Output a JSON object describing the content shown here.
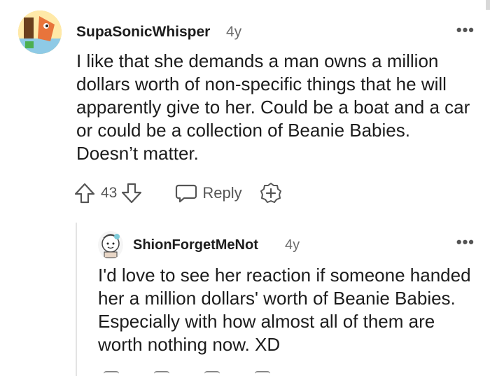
{
  "comments": [
    {
      "author": "SupaSonicWhisper",
      "age": "4y",
      "text": "I like that she demands a man owns a million dollars worth of non-specific things that he will apparently give to her. Could be a boat and a car or could be a collection of Beanie Babies. Doesn’t matter.",
      "votes": "43",
      "reply_label": "Reply"
    },
    {
      "author": "ShionForgetMeNot",
      "age": "4y",
      "text": "I'd love to see her reaction if someone handed her a million dollars' worth of Beanie Babies. Especially with how almost all of them are worth nothing now. XD"
    }
  ],
  "icons": {
    "upvote": "upvote-icon",
    "downvote": "downvote-icon",
    "reply": "reply-bubble-icon",
    "award": "award-plus-icon",
    "more": "more-options-icon"
  },
  "colors": {
    "text": "#1c1c1c",
    "muted": "#6a6a6a",
    "thread_line": "#e3e3e3"
  },
  "more_glyph": "•••"
}
